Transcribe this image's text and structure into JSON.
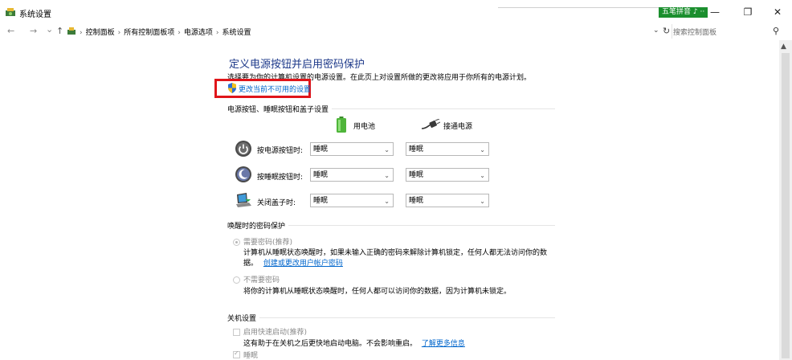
{
  "window": {
    "title": "系统设置",
    "ime_label": "五笔拼音 ♪ ⋅⋅",
    "minimize": "—",
    "restore": "❐",
    "close": "✕"
  },
  "address": {
    "back": "←",
    "forward": "→",
    "recent": "⌄",
    "up": "↑",
    "crumbs": [
      "控制面板",
      "所有控制面板项",
      "电源选项",
      "系统设置"
    ],
    "sep": "›",
    "dropdown": "⌄",
    "refresh": "↻",
    "search_placeholder": "搜索控制面板",
    "search_icon": "⚲"
  },
  "page": {
    "heading": "定义电源按钮并启用密码保护",
    "description": "选择要为你的计算机设置的电源设置。在此页上对设置所做的更改将应用于你所有的电源计划。",
    "change_link": "更改当前不可用的设置"
  },
  "power": {
    "section_title": "电源按钮、睡眠按钮和盖子设置",
    "col_battery": "用电池",
    "col_plugged": "接通电源",
    "rows": [
      {
        "label": "按电源按钮时:",
        "battery": "睡眠",
        "plugged": "睡眠"
      },
      {
        "label": "按睡眠按钮时:",
        "battery": "睡眠",
        "plugged": "睡眠"
      },
      {
        "label": "关闭盖子时:",
        "battery": "睡眠",
        "plugged": "睡眠"
      }
    ],
    "chevron": "⌄"
  },
  "password": {
    "section_title": "唤醒时的密码保护",
    "require_label": "需要密码(推荐)",
    "require_desc_1": "计算机从睡眠状态唤醒时，如果未输入正确的密码来解除计算机锁定，任何人都无法访问你的数",
    "require_desc_2": "据。",
    "create_link": "创建或更改用户帐户密码",
    "no_require_label": "不需要密码",
    "no_require_desc": "将你的计算机从睡眠状态唤醒时，任何人都可以访问你的数据，因为计算机未锁定。"
  },
  "shutdown": {
    "section_title": "关机设置",
    "fast_startup_label": "启用快速启动(推荐)",
    "fast_startup_desc": "这有助于在关机之后更快地启动电脑。不会影响重启。",
    "more_info_link": "了解更多信息",
    "sleep_label": "睡眠"
  },
  "colors": {
    "heading": "#1e3a8a",
    "link": "#0066cc",
    "highlight_box": "#e0151a",
    "ime_bg": "#1b8f2e"
  }
}
